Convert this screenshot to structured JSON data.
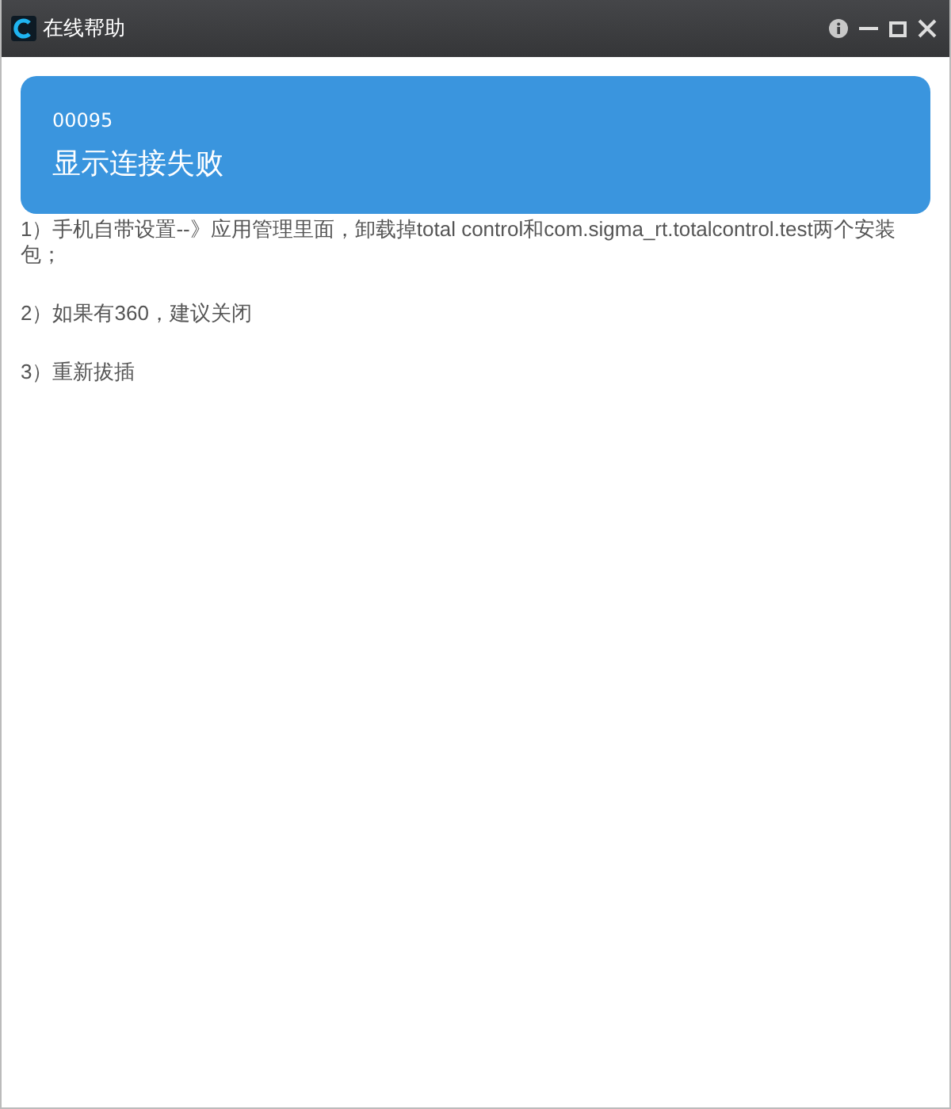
{
  "window": {
    "title": "在线帮助"
  },
  "error": {
    "code": "00095",
    "title": "显示连接失败"
  },
  "steps": [
    "1）手机自带设置--》应用管理里面，卸载掉total control和com.sigma_rt.totalcontrol.test两个安装包；",
    "2）如果有360，建议关闭",
    "3）重新拔插"
  ]
}
